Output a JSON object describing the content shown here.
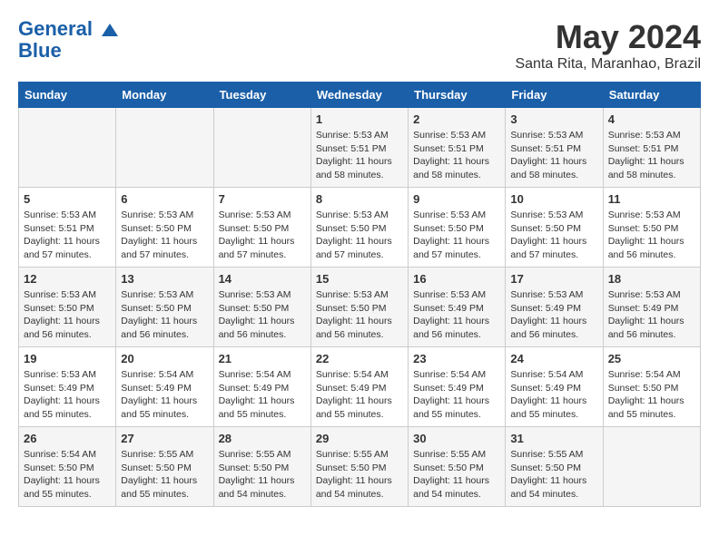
{
  "logo": {
    "line1": "General",
    "line2": "Blue"
  },
  "title": "May 2024",
  "location": "Santa Rita, Maranhao, Brazil",
  "days_header": [
    "Sunday",
    "Monday",
    "Tuesday",
    "Wednesday",
    "Thursday",
    "Friday",
    "Saturday"
  ],
  "weeks": [
    [
      {
        "num": "",
        "sunrise": "",
        "sunset": "",
        "daylight": ""
      },
      {
        "num": "",
        "sunrise": "",
        "sunset": "",
        "daylight": ""
      },
      {
        "num": "",
        "sunrise": "",
        "sunset": "",
        "daylight": ""
      },
      {
        "num": "1",
        "sunrise": "Sunrise: 5:53 AM",
        "sunset": "Sunset: 5:51 PM",
        "daylight": "Daylight: 11 hours and 58 minutes."
      },
      {
        "num": "2",
        "sunrise": "Sunrise: 5:53 AM",
        "sunset": "Sunset: 5:51 PM",
        "daylight": "Daylight: 11 hours and 58 minutes."
      },
      {
        "num": "3",
        "sunrise": "Sunrise: 5:53 AM",
        "sunset": "Sunset: 5:51 PM",
        "daylight": "Daylight: 11 hours and 58 minutes."
      },
      {
        "num": "4",
        "sunrise": "Sunrise: 5:53 AM",
        "sunset": "Sunset: 5:51 PM",
        "daylight": "Daylight: 11 hours and 58 minutes."
      }
    ],
    [
      {
        "num": "5",
        "sunrise": "Sunrise: 5:53 AM",
        "sunset": "Sunset: 5:51 PM",
        "daylight": "Daylight: 11 hours and 57 minutes."
      },
      {
        "num": "6",
        "sunrise": "Sunrise: 5:53 AM",
        "sunset": "Sunset: 5:50 PM",
        "daylight": "Daylight: 11 hours and 57 minutes."
      },
      {
        "num": "7",
        "sunrise": "Sunrise: 5:53 AM",
        "sunset": "Sunset: 5:50 PM",
        "daylight": "Daylight: 11 hours and 57 minutes."
      },
      {
        "num": "8",
        "sunrise": "Sunrise: 5:53 AM",
        "sunset": "Sunset: 5:50 PM",
        "daylight": "Daylight: 11 hours and 57 minutes."
      },
      {
        "num": "9",
        "sunrise": "Sunrise: 5:53 AM",
        "sunset": "Sunset: 5:50 PM",
        "daylight": "Daylight: 11 hours and 57 minutes."
      },
      {
        "num": "10",
        "sunrise": "Sunrise: 5:53 AM",
        "sunset": "Sunset: 5:50 PM",
        "daylight": "Daylight: 11 hours and 57 minutes."
      },
      {
        "num": "11",
        "sunrise": "Sunrise: 5:53 AM",
        "sunset": "Sunset: 5:50 PM",
        "daylight": "Daylight: 11 hours and 56 minutes."
      }
    ],
    [
      {
        "num": "12",
        "sunrise": "Sunrise: 5:53 AM",
        "sunset": "Sunset: 5:50 PM",
        "daylight": "Daylight: 11 hours and 56 minutes."
      },
      {
        "num": "13",
        "sunrise": "Sunrise: 5:53 AM",
        "sunset": "Sunset: 5:50 PM",
        "daylight": "Daylight: 11 hours and 56 minutes."
      },
      {
        "num": "14",
        "sunrise": "Sunrise: 5:53 AM",
        "sunset": "Sunset: 5:50 PM",
        "daylight": "Daylight: 11 hours and 56 minutes."
      },
      {
        "num": "15",
        "sunrise": "Sunrise: 5:53 AM",
        "sunset": "Sunset: 5:50 PM",
        "daylight": "Daylight: 11 hours and 56 minutes."
      },
      {
        "num": "16",
        "sunrise": "Sunrise: 5:53 AM",
        "sunset": "Sunset: 5:49 PM",
        "daylight": "Daylight: 11 hours and 56 minutes."
      },
      {
        "num": "17",
        "sunrise": "Sunrise: 5:53 AM",
        "sunset": "Sunset: 5:49 PM",
        "daylight": "Daylight: 11 hours and 56 minutes."
      },
      {
        "num": "18",
        "sunrise": "Sunrise: 5:53 AM",
        "sunset": "Sunset: 5:49 PM",
        "daylight": "Daylight: 11 hours and 56 minutes."
      }
    ],
    [
      {
        "num": "19",
        "sunrise": "Sunrise: 5:53 AM",
        "sunset": "Sunset: 5:49 PM",
        "daylight": "Daylight: 11 hours and 55 minutes."
      },
      {
        "num": "20",
        "sunrise": "Sunrise: 5:54 AM",
        "sunset": "Sunset: 5:49 PM",
        "daylight": "Daylight: 11 hours and 55 minutes."
      },
      {
        "num": "21",
        "sunrise": "Sunrise: 5:54 AM",
        "sunset": "Sunset: 5:49 PM",
        "daylight": "Daylight: 11 hours and 55 minutes."
      },
      {
        "num": "22",
        "sunrise": "Sunrise: 5:54 AM",
        "sunset": "Sunset: 5:49 PM",
        "daylight": "Daylight: 11 hours and 55 minutes."
      },
      {
        "num": "23",
        "sunrise": "Sunrise: 5:54 AM",
        "sunset": "Sunset: 5:49 PM",
        "daylight": "Daylight: 11 hours and 55 minutes."
      },
      {
        "num": "24",
        "sunrise": "Sunrise: 5:54 AM",
        "sunset": "Sunset: 5:49 PM",
        "daylight": "Daylight: 11 hours and 55 minutes."
      },
      {
        "num": "25",
        "sunrise": "Sunrise: 5:54 AM",
        "sunset": "Sunset: 5:50 PM",
        "daylight": "Daylight: 11 hours and 55 minutes."
      }
    ],
    [
      {
        "num": "26",
        "sunrise": "Sunrise: 5:54 AM",
        "sunset": "Sunset: 5:50 PM",
        "daylight": "Daylight: 11 hours and 55 minutes."
      },
      {
        "num": "27",
        "sunrise": "Sunrise: 5:55 AM",
        "sunset": "Sunset: 5:50 PM",
        "daylight": "Daylight: 11 hours and 55 minutes."
      },
      {
        "num": "28",
        "sunrise": "Sunrise: 5:55 AM",
        "sunset": "Sunset: 5:50 PM",
        "daylight": "Daylight: 11 hours and 54 minutes."
      },
      {
        "num": "29",
        "sunrise": "Sunrise: 5:55 AM",
        "sunset": "Sunset: 5:50 PM",
        "daylight": "Daylight: 11 hours and 54 minutes."
      },
      {
        "num": "30",
        "sunrise": "Sunrise: 5:55 AM",
        "sunset": "Sunset: 5:50 PM",
        "daylight": "Daylight: 11 hours and 54 minutes."
      },
      {
        "num": "31",
        "sunrise": "Sunrise: 5:55 AM",
        "sunset": "Sunset: 5:50 PM",
        "daylight": "Daylight: 11 hours and 54 minutes."
      },
      {
        "num": "",
        "sunrise": "",
        "sunset": "",
        "daylight": ""
      }
    ]
  ]
}
